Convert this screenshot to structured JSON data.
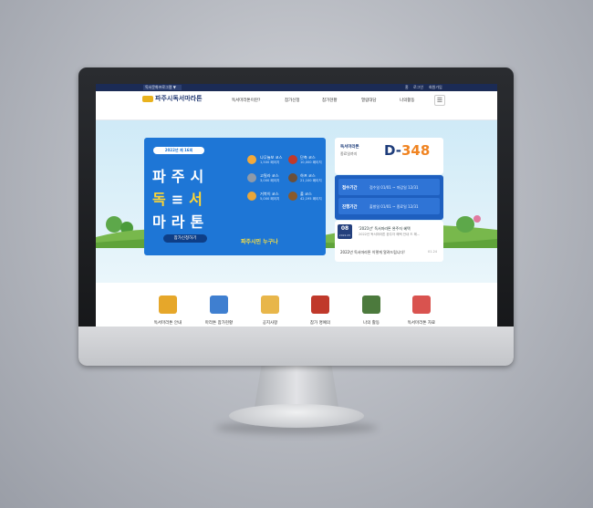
{
  "topbar": {
    "family_select": "독서문화프로그램 ▼",
    "links": [
      "홈",
      "로그인",
      "회원가입"
    ]
  },
  "header": {
    "logo_text": "파주시독서마라톤",
    "nav": [
      "독서마라톤이란?",
      "참가신청",
      "참가현황",
      "열람대담",
      "나의활동"
    ],
    "menu_icon": "☰"
  },
  "banner": {
    "year_badge": "2022년 제 16회",
    "title_line1": "파주시",
    "title_dok": "독",
    "title_seo": "서",
    "title_line3": "마라톤",
    "apply_button": "참가신청하기",
    "courses": [
      {
        "name": "나무늘보 코스",
        "pages": "1,500 페이지",
        "color": "#f2a93b"
      },
      {
        "name": "고릴라 코스",
        "pages": "3,000 페이지",
        "color": "#8f9aa8"
      },
      {
        "name": "거북이 코스",
        "pages": "5,000 페이지",
        "color": "#e8a63a"
      },
      {
        "name": "단축 코스",
        "pages": "10,000 페이지",
        "color": "#c0392b"
      },
      {
        "name": "하프 코스",
        "pages": "21,100 페이지",
        "color": "#6b4f3a"
      },
      {
        "name": "풀 코스",
        "pages": "42,195 페이지",
        "color": "#8a5a2b"
      }
    ],
    "slogan": "파주시민 누구나"
  },
  "dday": {
    "title": "독서마라톤",
    "subtitle": "종료일까지",
    "prefix": "D-",
    "number": "348"
  },
  "periods": [
    {
      "label": "접수기간",
      "value": "접수일 01/01 ~ 마감일 12/31"
    },
    {
      "label": "진행기간",
      "value": "출발일 01/01 ~ 종료일 12/31"
    }
  ],
  "notice": {
    "day": "08",
    "year_month": "2022.05",
    "item1": "'2021년' 독서마라톤 완주자 혜택",
    "item1_sub": "2022년 독서마라톤 완주자 혜택 안내 드 해...",
    "item2": "2022년 독서마라톤 이렇게 알려드립니다!",
    "item2_date": "01.24"
  },
  "quick_menu": [
    {
      "label": "독서마라톤 안내",
      "color": "#e6a72a"
    },
    {
      "label": "마라톤 참가현황",
      "color": "#3f7fd0"
    },
    {
      "label": "공지사항",
      "color": "#e8b64a"
    },
    {
      "label": "참가 명예의",
      "color": "#c0392b"
    },
    {
      "label": "나의 활동",
      "color": "#4c7a3d"
    },
    {
      "label": "독서마라톤 자료",
      "color": "#d9534f"
    }
  ]
}
